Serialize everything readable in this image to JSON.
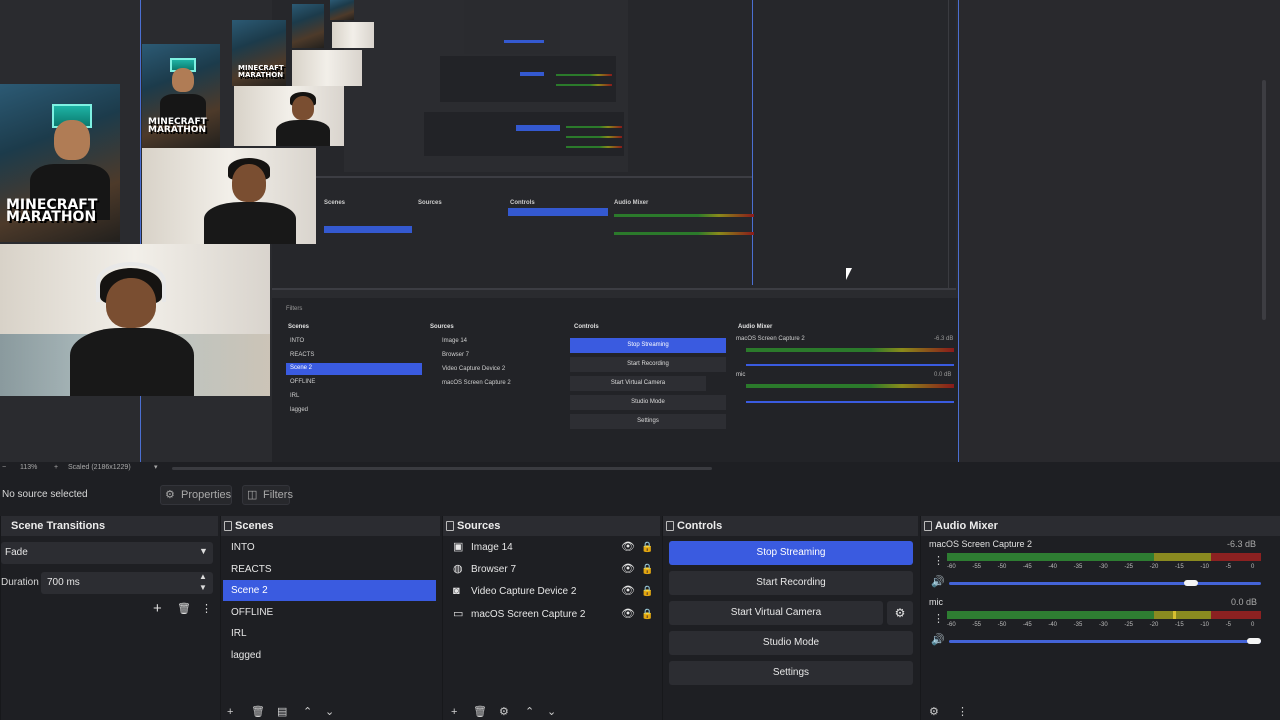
{
  "preview": {
    "thumb_title": "MINECRAFT MARATHON",
    "nested": {
      "scenes_title": "Scenes",
      "sources_title": "Sources",
      "controls_title": "Controls",
      "mixer_title": "Audio Mixer",
      "filters_tab": "Filters",
      "scenes": [
        "INTO",
        "REACTS",
        "Scene 2",
        "OFFLINE",
        "IRL",
        "lagged"
      ],
      "sources": [
        "Image 14",
        "Browser 7",
        "Video Capture Device 2",
        "macOS Screen Capture 2"
      ],
      "controls": [
        "Stop Streaming",
        "Start Recording",
        "Start Virtual Camera",
        "Studio Mode",
        "Settings"
      ],
      "mixer_track1": "macOS Screen Capture 2",
      "mixer_track1_db": "-6.3 dB",
      "mixer_track2": "mic",
      "mixer_track2_db": "0.0 dB"
    }
  },
  "zoombar": {
    "zoom": "113%",
    "scaled": "Scaled (2186x1229)"
  },
  "source_bar": {
    "no_source": "No source selected",
    "properties": "Properties",
    "filters": "Filters"
  },
  "scene_transitions": {
    "title": "Scene Transitions",
    "transition": "Fade",
    "duration_label": "Duration",
    "duration_value": "700 ms"
  },
  "scenes": {
    "title": "Scenes",
    "items": [
      "INTO",
      "REACTS",
      "Scene 2",
      "OFFLINE",
      "IRL",
      "lagged"
    ],
    "selected_index": 2
  },
  "sources": {
    "title": "Sources",
    "items": [
      {
        "label": "Image 14",
        "icon": "image-icon"
      },
      {
        "label": "Browser 7",
        "icon": "browser-icon"
      },
      {
        "label": "Video Capture Device 2",
        "icon": "camera-icon"
      },
      {
        "label": "macOS Screen Capture 2",
        "icon": "display-icon"
      }
    ]
  },
  "controls": {
    "title": "Controls",
    "stop_streaming": "Stop Streaming",
    "start_recording": "Start Recording",
    "start_virtual_camera": "Start Virtual Camera",
    "studio_mode": "Studio Mode",
    "settings": "Settings"
  },
  "audio_mixer": {
    "title": "Audio Mixer",
    "scale_ticks": [
      "-60",
      "-55",
      "-50",
      "-45",
      "-40",
      "-35",
      "-30",
      "-25",
      "-20",
      "-15",
      "-10",
      "-5",
      "0"
    ],
    "tracks": [
      {
        "name": "macOS Screen Capture 2",
        "db": "-6.3 dB",
        "volume_fraction": 0.79
      },
      {
        "name": "mic",
        "db": "0.0 dB",
        "volume_fraction": 1.0
      }
    ]
  },
  "colors": {
    "accent": "#3a5be0",
    "background": "#1e1f23",
    "dock_header": "#2b2c31"
  }
}
